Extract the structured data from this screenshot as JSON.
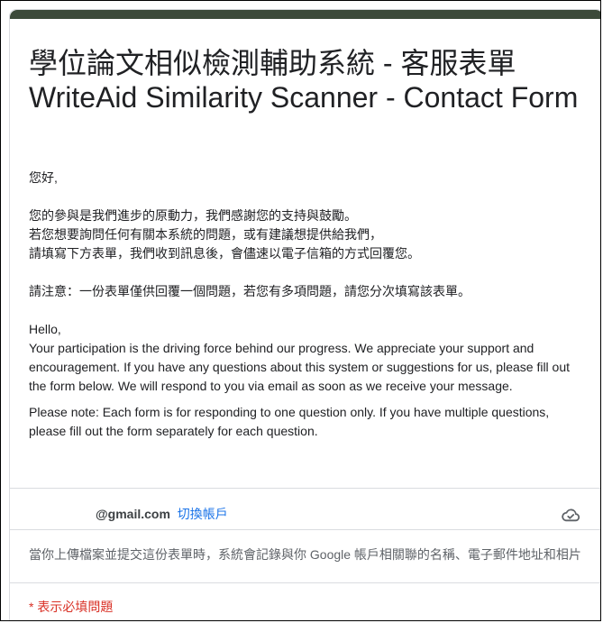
{
  "form": {
    "title": "學位論文相似檢測輔助系統 - 客服表單 WriteAid Similarity Scanner - Contact Form",
    "description": {
      "zh_greeting": "您好,",
      "zh_line1": "您的參與是我們進步的原動力，我們感謝您的支持與鼓勵。",
      "zh_line2": "若您想要詢問任何有關本系統的問題，或有建議想提供給我們，",
      "zh_line3": "請填寫下方表單，我們收到訊息後，會儘速以電子信箱的方式回覆您。",
      "zh_note": "請注意：一份表單僅供回覆一個問題，若您有多項問題，請您分次填寫該表單。",
      "en_greeting": "Hello,",
      "en_body": "Your participation is the driving force behind our progress. We appreciate your support and encouragement. If you have any questions about this system or suggestions for us, please fill out the form below. We will respond to you via email as soon as we receive your message.",
      "en_note": "Please note: Each form is for responding to one question only. If you have multiple questions, please fill out the form separately for each question."
    },
    "account": {
      "email": "@gmail.com",
      "switch_label": "切換帳戶",
      "icon": "cloud-check-icon"
    },
    "notice": "當你上傳檔案並提交這份表單時，系統會記錄與你 Google 帳戶相關聯的名稱、電子郵件地址和相片",
    "required_note": "* 表示必填問題"
  },
  "colors": {
    "accent": "#3c4a3a",
    "link": "#1a73e8",
    "required": "#d93025"
  }
}
